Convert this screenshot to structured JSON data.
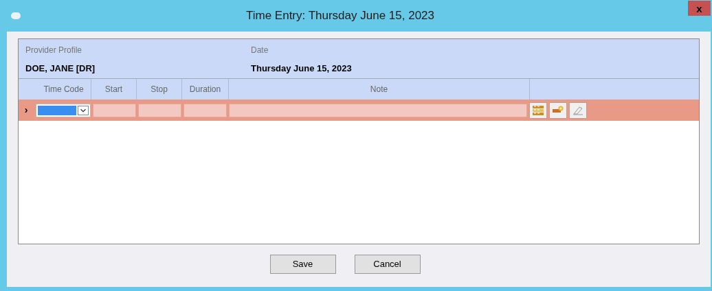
{
  "window": {
    "title": "Time Entry: Thursday June 15, 2023",
    "close": "x"
  },
  "provider": {
    "label": "Provider Profile",
    "value": "DOE, JANE [DR]"
  },
  "date": {
    "label": "Date",
    "value": "Thursday June 15, 2023"
  },
  "table": {
    "columns": [
      "Time Code",
      "Start",
      "Stop",
      "Duration",
      "Note"
    ],
    "rows": [
      {
        "indicator": "›",
        "selected": true
      }
    ]
  },
  "buttons": [
    "Save",
    "Cancel"
  ]
}
